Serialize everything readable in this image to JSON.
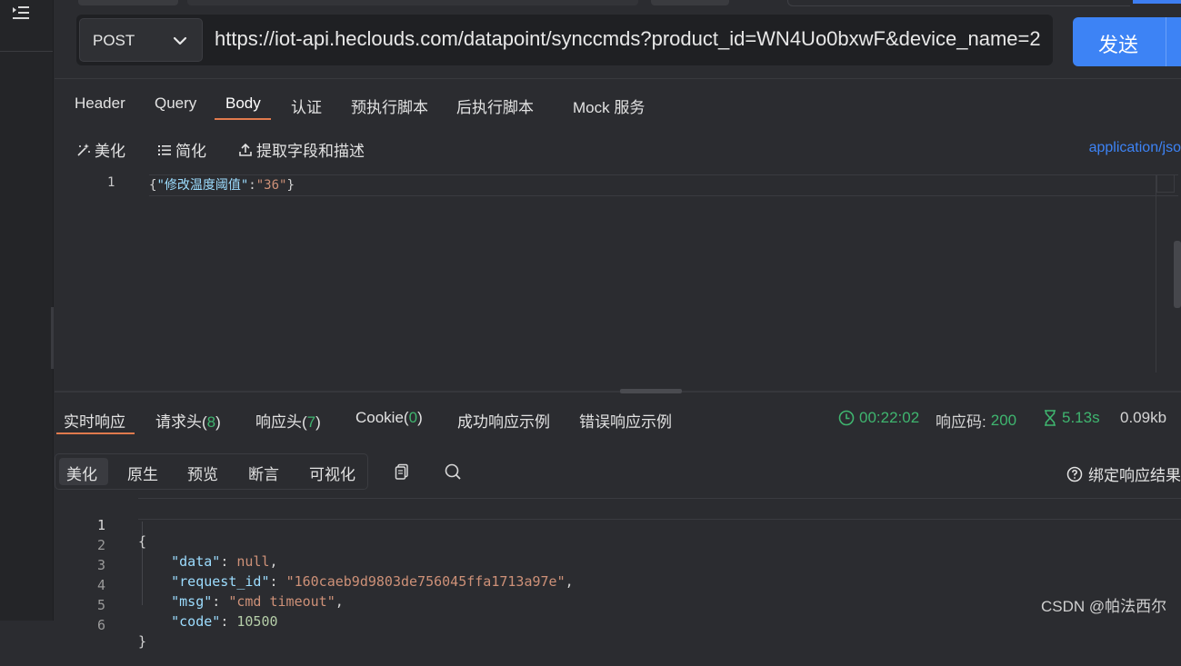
{
  "request": {
    "method": "POST",
    "url": "https://iot-api.heclouds.com/datapoint/synccmds?product_id=WN4Uo0bxwF&device_name=2",
    "send_label": "发送",
    "tabs": [
      "Header",
      "Query",
      "Body",
      "认证",
      "预执行脚本",
      "后执行脚本",
      "Mock 服务"
    ],
    "active_tab": "Body",
    "toolbar": {
      "beautify": "美化",
      "simplify": "简化",
      "extract": "提取字段和描述",
      "content_type": "application/jso"
    },
    "body_lines": [
      {
        "no": "1",
        "open": "{",
        "key": "\"修改温度阈值\"",
        "colon": ":",
        "value": "\"36\"",
        "close": "}"
      }
    ]
  },
  "response": {
    "tabs": {
      "realtime": "实时响应",
      "req_headers": "请求头(",
      "req_headers_count": "8",
      "res_headers": "响应头(",
      "res_headers_count": "7",
      "cookie": "Cookie(",
      "cookie_count": "0",
      "close_paren": ")",
      "success_example": "成功响应示例",
      "error_example": "错误响应示例"
    },
    "time": "00:22:02",
    "status_label": "响应码:",
    "status_code": "200",
    "duration": "5.13s",
    "size": "0.09kb",
    "view_tabs": [
      "美化",
      "原生",
      "预览",
      "断言",
      "可视化"
    ],
    "active_view": "美化",
    "bind_result": "绑定响应结果",
    "lines": [
      {
        "no": "1",
        "key": "",
        "value": "",
        "text": "{"
      },
      {
        "no": "2",
        "key": "\"data\"",
        "value": "null",
        "text": ","
      },
      {
        "no": "3",
        "key": "\"request_id\"",
        "value": "\"160caeb9d9803de756045ffa1713a97e\"",
        "text": ","
      },
      {
        "no": "4",
        "key": "\"msg\"",
        "value": "\"cmd timeout\"",
        "text": ","
      },
      {
        "no": "5",
        "key": "\"code\"",
        "value": "10500",
        "text": ""
      },
      {
        "no": "6",
        "key": "",
        "value": "",
        "text": "}"
      }
    ]
  },
  "watermark": "CSDN @帕法西尔",
  "colors": {
    "accent": "#3d83f5",
    "tab_underline": "#e07a4d",
    "success": "#3fb56f"
  }
}
